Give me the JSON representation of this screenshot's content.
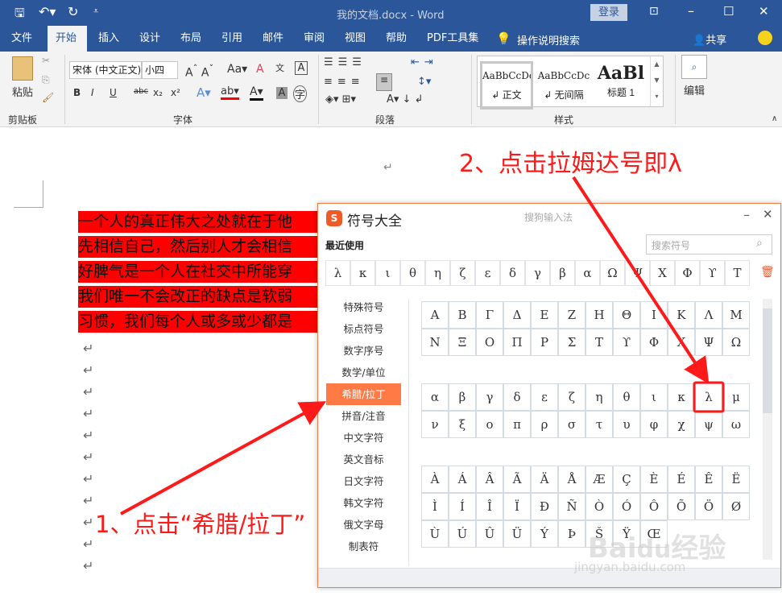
{
  "window": {
    "title": "我的文档.docx  -  Word",
    "signin": "登录"
  },
  "quick_access": {
    "save": "save-icon",
    "undo": "undo-icon",
    "redo": "redo-icon",
    "customize": "customize-icon"
  },
  "tabs": [
    "文件",
    "开始",
    "插入",
    "设计",
    "布局",
    "引用",
    "邮件",
    "审阅",
    "视图",
    "帮助",
    "PDF工具集"
  ],
  "tell_me": "操作说明搜索",
  "share": "共享",
  "ribbon": {
    "clipboard": {
      "paste": "粘贴",
      "label": "剪贴板"
    },
    "font": {
      "name": "宋体 (中文正文)",
      "size": "小四",
      "label": "字体",
      "buttons": [
        "B",
        "I",
        "U",
        "abc",
        "x₂",
        "x²"
      ]
    },
    "paragraph": {
      "label": "段落"
    },
    "styles": {
      "label": "样式",
      "items": [
        {
          "preview": "AaBbCcDc",
          "name": "↲ 正文"
        },
        {
          "preview": "AaBbCcDc",
          "name": "↲ 无间隔"
        },
        {
          "preview": "AaBl",
          "name": "标题 1"
        }
      ]
    },
    "editing": {
      "label": "编辑"
    }
  },
  "document": {
    "lines": [
      "一个人的真正伟大之处就在于他",
      "先相信自己，然后别人才会相信",
      "好脾气是一个人在社交中所能穿",
      "我们唯一不会改正的缺点是软弱",
      "习惯，我们每个人或多或少都是"
    ],
    "return_mark": "↵"
  },
  "dialog": {
    "title": "符号大全",
    "subtitle": "搜狗输入法",
    "recent_label": "最近使用",
    "search_placeholder": "搜索符号",
    "recent": [
      "λ",
      "κ",
      "ι",
      "θ",
      "η",
      "ζ",
      "ε",
      "δ",
      "γ",
      "β",
      "α",
      "Ω",
      "Ψ",
      "Χ",
      "Φ",
      "ϒ",
      "Τ"
    ],
    "categories": [
      "特殊符号",
      "标点符号",
      "数字序号",
      "数学/单位",
      "希腊/拉丁",
      "拼音/注音",
      "中文字符",
      "英文音标",
      "日文字符",
      "韩文字符",
      "俄文字母",
      "制表符"
    ],
    "active_category": "希腊/拉丁",
    "greek_upper": [
      "Α",
      "Β",
      "Γ",
      "Δ",
      "Ε",
      "Ζ",
      "Η",
      "Θ",
      "Ι",
      "Κ",
      "Λ",
      "Μ",
      "Ν",
      "Ξ",
      "Ο",
      "Π",
      "Ρ",
      "Σ",
      "Τ",
      "ϒ",
      "Φ",
      "Χ",
      "Ψ",
      "Ω"
    ],
    "greek_lower": [
      "α",
      "β",
      "γ",
      "δ",
      "ε",
      "ζ",
      "η",
      "θ",
      "ι",
      "κ",
      "λ",
      "μ",
      "ν",
      "ξ",
      "ο",
      "π",
      "ρ",
      "σ",
      "τ",
      "υ",
      "φ",
      "χ",
      "ψ",
      "ω"
    ],
    "latin": [
      "À",
      "Á",
      "Â",
      "Ã",
      "Ä",
      "Å",
      "Æ",
      "Ç",
      "È",
      "É",
      "Ê",
      "Ë",
      "Ì",
      "Í",
      "Î",
      "Ï",
      "Đ",
      "Ñ",
      "Ò",
      "Ó",
      "Ô",
      "Õ",
      "Ö",
      "Ø",
      "Ù",
      "Ú",
      "Û",
      "Ü",
      "Ý",
      "Þ",
      "Š",
      "Ÿ",
      "Œ"
    ],
    "highlighted": "λ"
  },
  "annotations": {
    "step1": "1、点击“希腊/拉丁”",
    "step2": "2、点击拉姆达号即λ",
    "color": "#ff1a1a"
  },
  "watermark": {
    "logo": "Baidu经验",
    "url": "jingyan.baidu.com"
  }
}
